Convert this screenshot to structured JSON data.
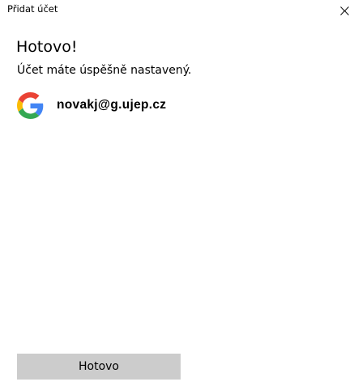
{
  "window": {
    "title": "Přidat účet",
    "close_icon": "close-icon"
  },
  "main": {
    "heading": "Hotovo!",
    "message": "Účet máte úspěšně nastavený.",
    "account": {
      "provider_icon": "google-logo-icon",
      "email": "novakj@g.ujep.cz"
    }
  },
  "footer": {
    "done_label": "Hotovo"
  },
  "colors": {
    "background": "#ffffff",
    "button_background": "#cccccc",
    "google_blue": "#4285F4",
    "google_red": "#EA4335",
    "google_yellow": "#FBBC05",
    "google_green": "#34A853"
  }
}
